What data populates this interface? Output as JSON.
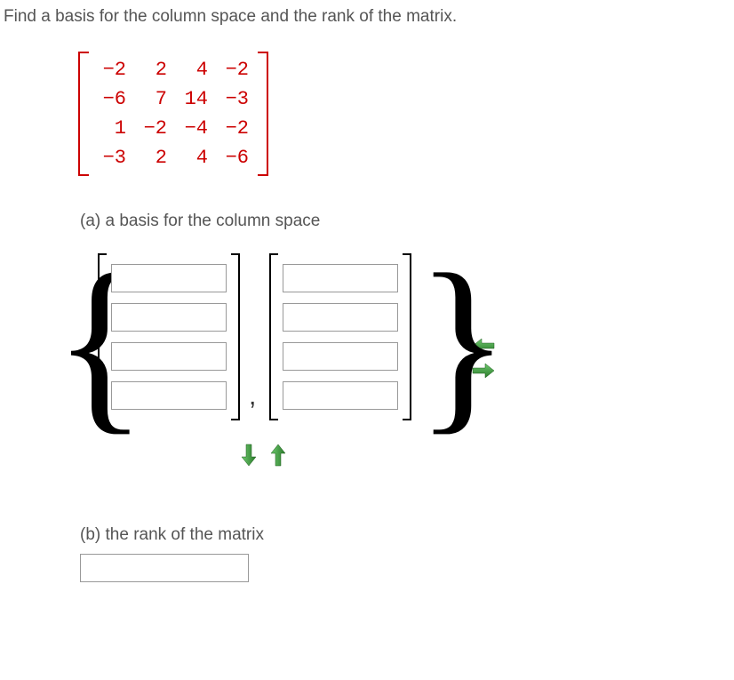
{
  "question": {
    "title": "Find a basis for the column space and the rank of the matrix."
  },
  "matrix": {
    "rows": [
      [
        "−2",
        "2",
        "4",
        "−2"
      ],
      [
        "−6",
        "7",
        "14",
        "−3"
      ],
      [
        "1",
        "−2",
        "−4",
        "−2"
      ],
      [
        "−3",
        "2",
        "4",
        "−6"
      ]
    ]
  },
  "parts": {
    "a": {
      "label": "(a) a basis for the column space"
    },
    "b": {
      "label": "(b) the rank of the matrix"
    }
  },
  "inputs": {
    "vector1": [
      "",
      "",
      "",
      ""
    ],
    "vector2": [
      "",
      "",
      "",
      ""
    ],
    "rank": ""
  },
  "icons": {
    "arrow_left": "arrow-left-icon",
    "arrow_right": "arrow-right-icon",
    "arrow_down": "arrow-down-icon",
    "arrow_up": "arrow-up-icon"
  },
  "colors": {
    "matrix_red": "#c00",
    "arrow_green": "#3a9b3a",
    "arrow_dark": "#2a7a2a"
  }
}
